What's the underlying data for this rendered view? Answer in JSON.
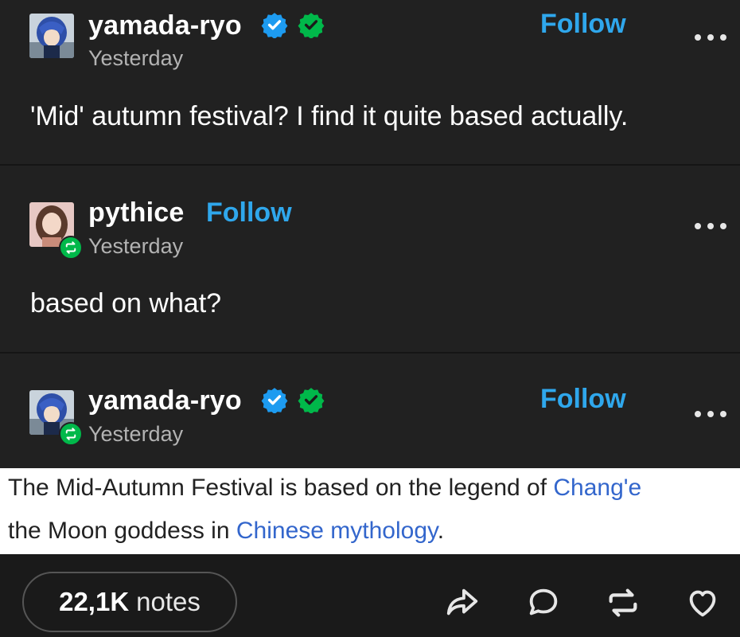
{
  "posts": [
    {
      "username": "yamada-ryo",
      "time": "Yesterday",
      "follow_label": "Follow",
      "text": "'Mid' autumn festival? I find it quite based actually.",
      "badges": [
        "blue-verified-icon",
        "green-verified-icon"
      ]
    },
    {
      "username": "pythice",
      "time": "Yesterday",
      "follow_label": "Follow",
      "text": "based on what?",
      "reblog_badge": "reblog-icon"
    },
    {
      "username": "yamada-ryo",
      "time": "Yesterday",
      "follow_label": "Follow",
      "badges": [
        "blue-verified-icon",
        "green-verified-icon"
      ],
      "reblog_badge": "reblog-icon"
    }
  ],
  "wiki_quote": {
    "line1_text": "The Mid-Autumn Festival is based on the legend of ",
    "line1_link": "Chang'e",
    "line2_prefix": "the Moon goddess in ",
    "line2_link": "Chinese mythology",
    "line2_suffix": "."
  },
  "footer": {
    "notes_count": "22,1K",
    "notes_label": "notes",
    "actions": [
      "share-icon",
      "reply-icon",
      "reblog-icon",
      "like-icon"
    ]
  },
  "colors": {
    "background": "#212121",
    "follow": "#2fa7ec",
    "verified_blue": "#1d9bf0",
    "verified_green": "#00b84a",
    "link": "#3366cc"
  }
}
